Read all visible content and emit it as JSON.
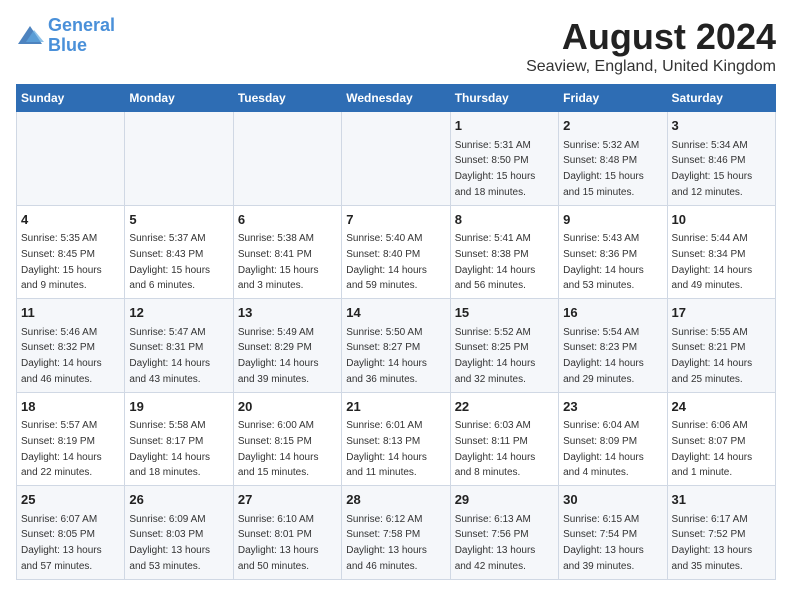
{
  "logo": {
    "line1": "General",
    "line2": "Blue"
  },
  "title": "August 2024",
  "subtitle": "Seaview, England, United Kingdom",
  "days_of_week": [
    "Sunday",
    "Monday",
    "Tuesday",
    "Wednesday",
    "Thursday",
    "Friday",
    "Saturday"
  ],
  "weeks": [
    [
      {
        "day": "",
        "info": ""
      },
      {
        "day": "",
        "info": ""
      },
      {
        "day": "",
        "info": ""
      },
      {
        "day": "",
        "info": ""
      },
      {
        "day": "1",
        "info": "Sunrise: 5:31 AM\nSunset: 8:50 PM\nDaylight: 15 hours\nand 18 minutes."
      },
      {
        "day": "2",
        "info": "Sunrise: 5:32 AM\nSunset: 8:48 PM\nDaylight: 15 hours\nand 15 minutes."
      },
      {
        "day": "3",
        "info": "Sunrise: 5:34 AM\nSunset: 8:46 PM\nDaylight: 15 hours\nand 12 minutes."
      }
    ],
    [
      {
        "day": "4",
        "info": "Sunrise: 5:35 AM\nSunset: 8:45 PM\nDaylight: 15 hours\nand 9 minutes."
      },
      {
        "day": "5",
        "info": "Sunrise: 5:37 AM\nSunset: 8:43 PM\nDaylight: 15 hours\nand 6 minutes."
      },
      {
        "day": "6",
        "info": "Sunrise: 5:38 AM\nSunset: 8:41 PM\nDaylight: 15 hours\nand 3 minutes."
      },
      {
        "day": "7",
        "info": "Sunrise: 5:40 AM\nSunset: 8:40 PM\nDaylight: 14 hours\nand 59 minutes."
      },
      {
        "day": "8",
        "info": "Sunrise: 5:41 AM\nSunset: 8:38 PM\nDaylight: 14 hours\nand 56 minutes."
      },
      {
        "day": "9",
        "info": "Sunrise: 5:43 AM\nSunset: 8:36 PM\nDaylight: 14 hours\nand 53 minutes."
      },
      {
        "day": "10",
        "info": "Sunrise: 5:44 AM\nSunset: 8:34 PM\nDaylight: 14 hours\nand 49 minutes."
      }
    ],
    [
      {
        "day": "11",
        "info": "Sunrise: 5:46 AM\nSunset: 8:32 PM\nDaylight: 14 hours\nand 46 minutes."
      },
      {
        "day": "12",
        "info": "Sunrise: 5:47 AM\nSunset: 8:31 PM\nDaylight: 14 hours\nand 43 minutes."
      },
      {
        "day": "13",
        "info": "Sunrise: 5:49 AM\nSunset: 8:29 PM\nDaylight: 14 hours\nand 39 minutes."
      },
      {
        "day": "14",
        "info": "Sunrise: 5:50 AM\nSunset: 8:27 PM\nDaylight: 14 hours\nand 36 minutes."
      },
      {
        "day": "15",
        "info": "Sunrise: 5:52 AM\nSunset: 8:25 PM\nDaylight: 14 hours\nand 32 minutes."
      },
      {
        "day": "16",
        "info": "Sunrise: 5:54 AM\nSunset: 8:23 PM\nDaylight: 14 hours\nand 29 minutes."
      },
      {
        "day": "17",
        "info": "Sunrise: 5:55 AM\nSunset: 8:21 PM\nDaylight: 14 hours\nand 25 minutes."
      }
    ],
    [
      {
        "day": "18",
        "info": "Sunrise: 5:57 AM\nSunset: 8:19 PM\nDaylight: 14 hours\nand 22 minutes."
      },
      {
        "day": "19",
        "info": "Sunrise: 5:58 AM\nSunset: 8:17 PM\nDaylight: 14 hours\nand 18 minutes."
      },
      {
        "day": "20",
        "info": "Sunrise: 6:00 AM\nSunset: 8:15 PM\nDaylight: 14 hours\nand 15 minutes."
      },
      {
        "day": "21",
        "info": "Sunrise: 6:01 AM\nSunset: 8:13 PM\nDaylight: 14 hours\nand 11 minutes."
      },
      {
        "day": "22",
        "info": "Sunrise: 6:03 AM\nSunset: 8:11 PM\nDaylight: 14 hours\nand 8 minutes."
      },
      {
        "day": "23",
        "info": "Sunrise: 6:04 AM\nSunset: 8:09 PM\nDaylight: 14 hours\nand 4 minutes."
      },
      {
        "day": "24",
        "info": "Sunrise: 6:06 AM\nSunset: 8:07 PM\nDaylight: 14 hours\nand 1 minute."
      }
    ],
    [
      {
        "day": "25",
        "info": "Sunrise: 6:07 AM\nSunset: 8:05 PM\nDaylight: 13 hours\nand 57 minutes."
      },
      {
        "day": "26",
        "info": "Sunrise: 6:09 AM\nSunset: 8:03 PM\nDaylight: 13 hours\nand 53 minutes."
      },
      {
        "day": "27",
        "info": "Sunrise: 6:10 AM\nSunset: 8:01 PM\nDaylight: 13 hours\nand 50 minutes."
      },
      {
        "day": "28",
        "info": "Sunrise: 6:12 AM\nSunset: 7:58 PM\nDaylight: 13 hours\nand 46 minutes."
      },
      {
        "day": "29",
        "info": "Sunrise: 6:13 AM\nSunset: 7:56 PM\nDaylight: 13 hours\nand 42 minutes."
      },
      {
        "day": "30",
        "info": "Sunrise: 6:15 AM\nSunset: 7:54 PM\nDaylight: 13 hours\nand 39 minutes."
      },
      {
        "day": "31",
        "info": "Sunrise: 6:17 AM\nSunset: 7:52 PM\nDaylight: 13 hours\nand 35 minutes."
      }
    ]
  ]
}
